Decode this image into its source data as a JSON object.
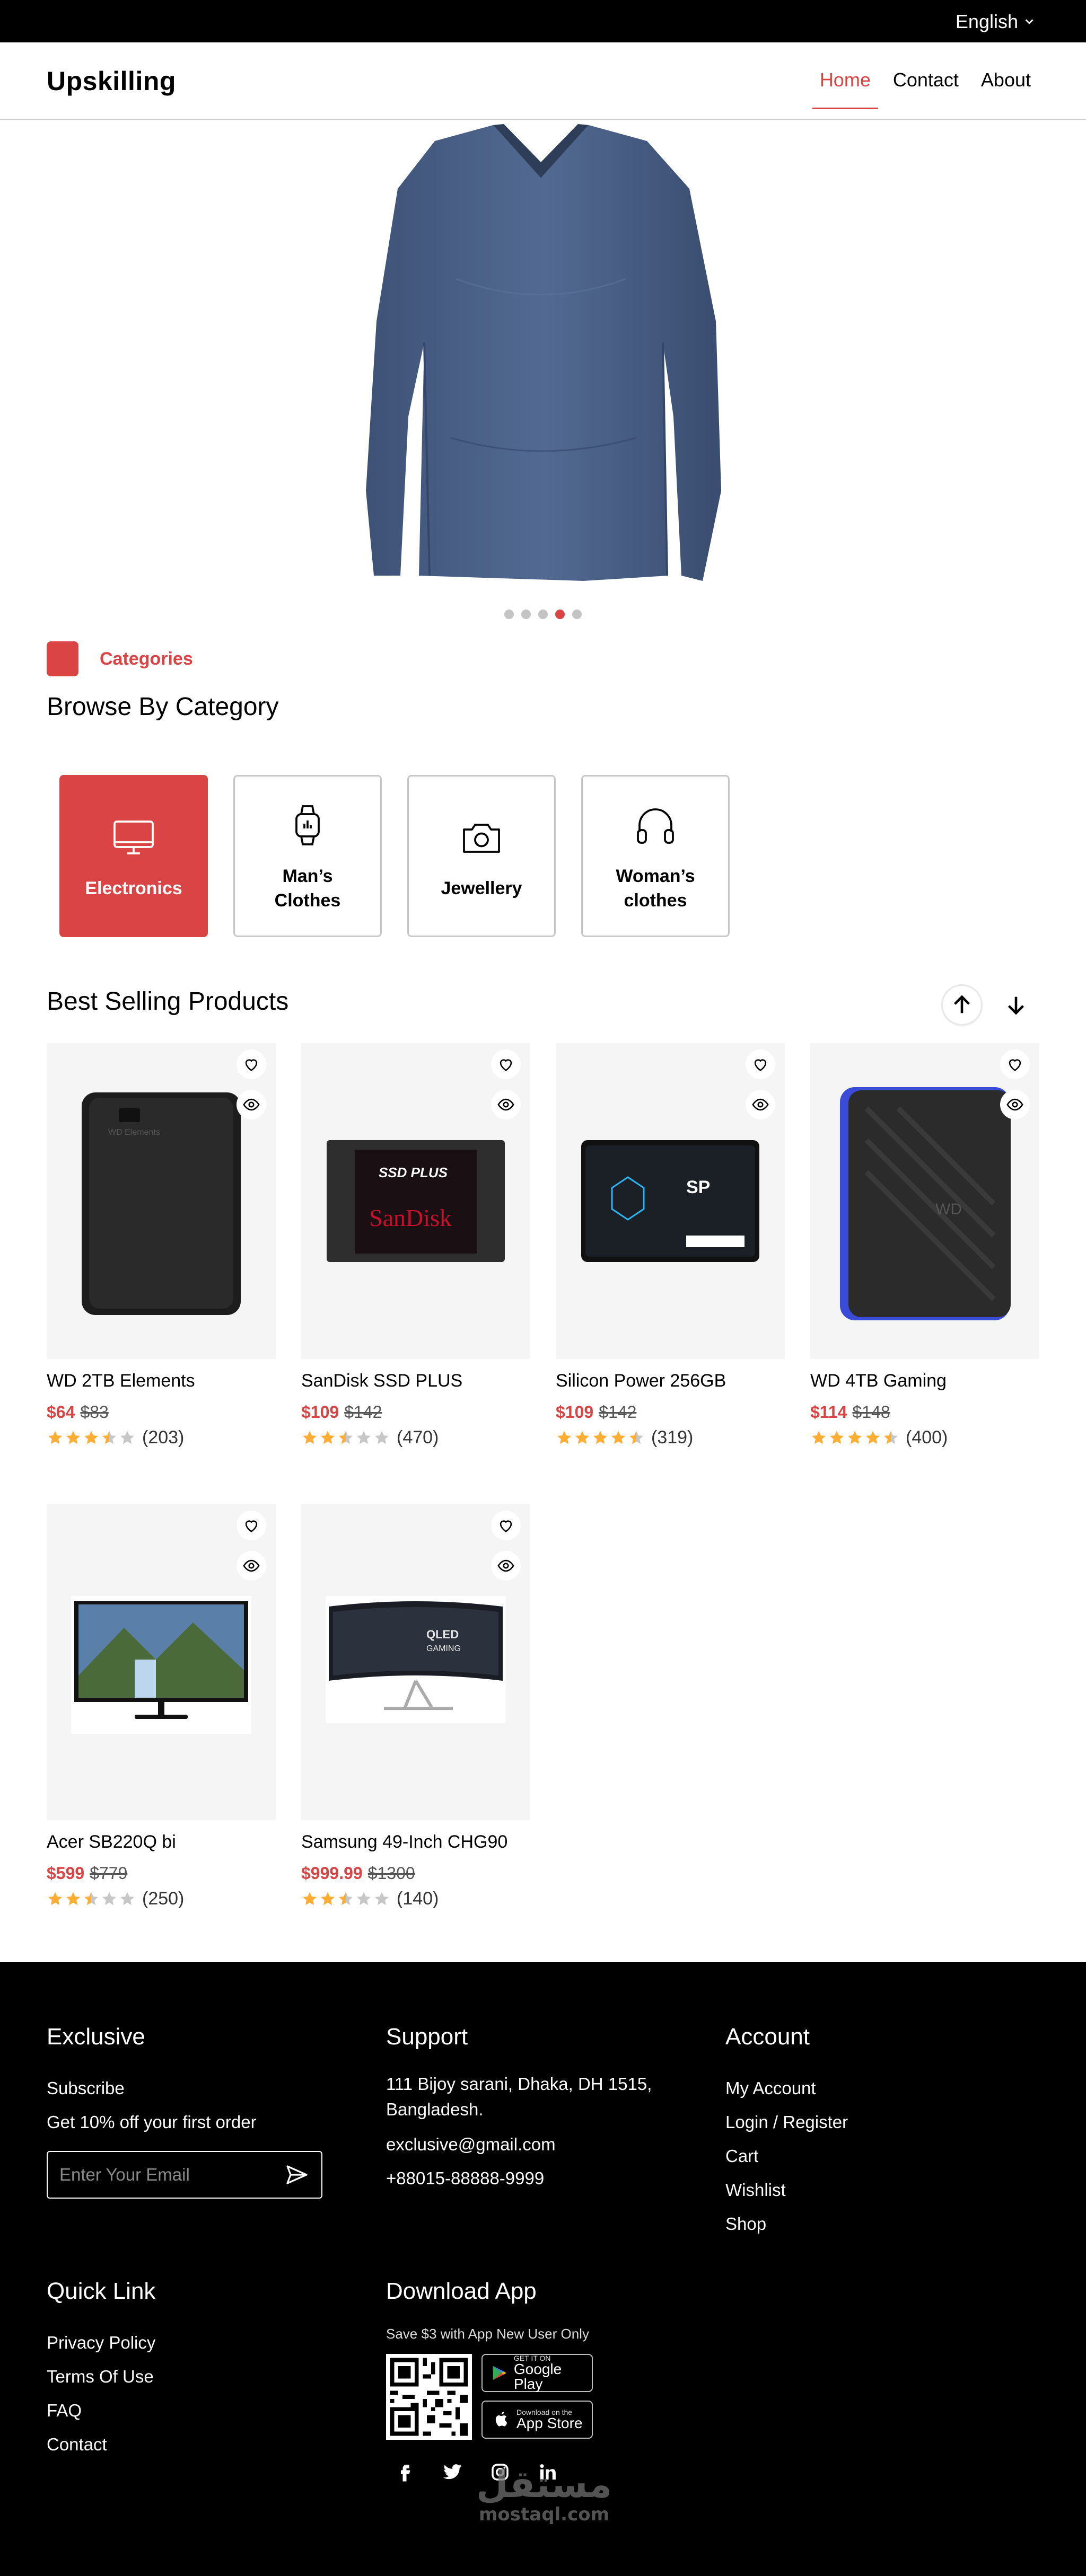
{
  "topbar": {
    "language": "English"
  },
  "header": {
    "logo": "Upskilling",
    "nav": [
      {
        "label": "Home",
        "active": true
      },
      {
        "label": "Contact",
        "active": false
      },
      {
        "label": "About",
        "active": false
      }
    ]
  },
  "hero": {
    "image_icon": "long-sleeve-shirt",
    "slides": 5,
    "active_slide": 4
  },
  "categories": {
    "tag": "Categories",
    "title": "Browse By Category",
    "items": [
      {
        "label": "Electronics",
        "icon": "monitor-icon",
        "active": true
      },
      {
        "label": "Man’s Clothes",
        "icon": "smartwatch-icon",
        "active": false
      },
      {
        "label": "Jewellery",
        "icon": "camera-icon",
        "active": false
      },
      {
        "label": "Woman’s clothes",
        "icon": "headphones-icon",
        "active": false
      }
    ]
  },
  "best_selling": {
    "title": "Best Selling Products",
    "products": [
      {
        "name": "WD 2TB Elements",
        "price": "$64",
        "old_price": "$83",
        "rating": 3.5,
        "reviews": "(203)",
        "icon": "external-hdd-black"
      },
      {
        "name": "SanDisk SSD PLUS",
        "price": "$109",
        "old_price": "$142",
        "rating": 2.5,
        "reviews": "(470)",
        "icon": "ssd-sandisk"
      },
      {
        "name": "Silicon Power 256GB",
        "price": "$109",
        "old_price": "$142",
        "rating": 4.5,
        "reviews": "(319)",
        "icon": "ssd-silicon-power"
      },
      {
        "name": "WD 4TB Gaming",
        "price": "$114",
        "old_price": "$148",
        "rating": 4.5,
        "reviews": "(400)",
        "icon": "external-hdd-gaming"
      },
      {
        "name": "Acer SB220Q bi",
        "price": "$599",
        "old_price": "$779",
        "rating": 2.5,
        "reviews": "(250)",
        "icon": "monitor-landscape"
      },
      {
        "name": "Samsung 49-Inch CHG90",
        "price": "$999.99",
        "old_price": "$1300",
        "rating": 2.5,
        "reviews": "(140)",
        "icon": "curved-monitor"
      }
    ]
  },
  "footer": {
    "exclusive": {
      "title": "Exclusive",
      "subscribe": "Subscribe",
      "offer": "Get 10% off your first order",
      "email_placeholder": "Enter Your Email"
    },
    "support": {
      "title": "Support",
      "address": "111 Bijoy sarani, Dhaka, DH 1515, Bangladesh.",
      "email": "exclusive@gmail.com",
      "phone": "+88015-88888-9999"
    },
    "account": {
      "title": "Account",
      "links": [
        "My Account",
        "Login / Register",
        "Cart",
        "Wishlist",
        "Shop"
      ]
    },
    "quick_link": {
      "title": "Quick Link",
      "links": [
        "Privacy Policy",
        "Terms Of Use",
        "FAQ",
        "Contact"
      ]
    },
    "download": {
      "title": "Download App",
      "note": "Save $3 with App New User Only",
      "google_play_small": "GET IT ON",
      "google_play": "Google Play",
      "app_store_small": "Download on the",
      "app_store": "App Store"
    },
    "socials": [
      "facebook-icon",
      "twitter-icon",
      "instagram-icon",
      "linkedin-icon"
    ],
    "watermark": {
      "arabic": "مستقل",
      "latin": "mostaql.com"
    }
  },
  "colors": {
    "accent": "#DB4444",
    "footer_bg": "#000000",
    "card_bg": "#F5F5F5",
    "star": "#FFAD33"
  }
}
